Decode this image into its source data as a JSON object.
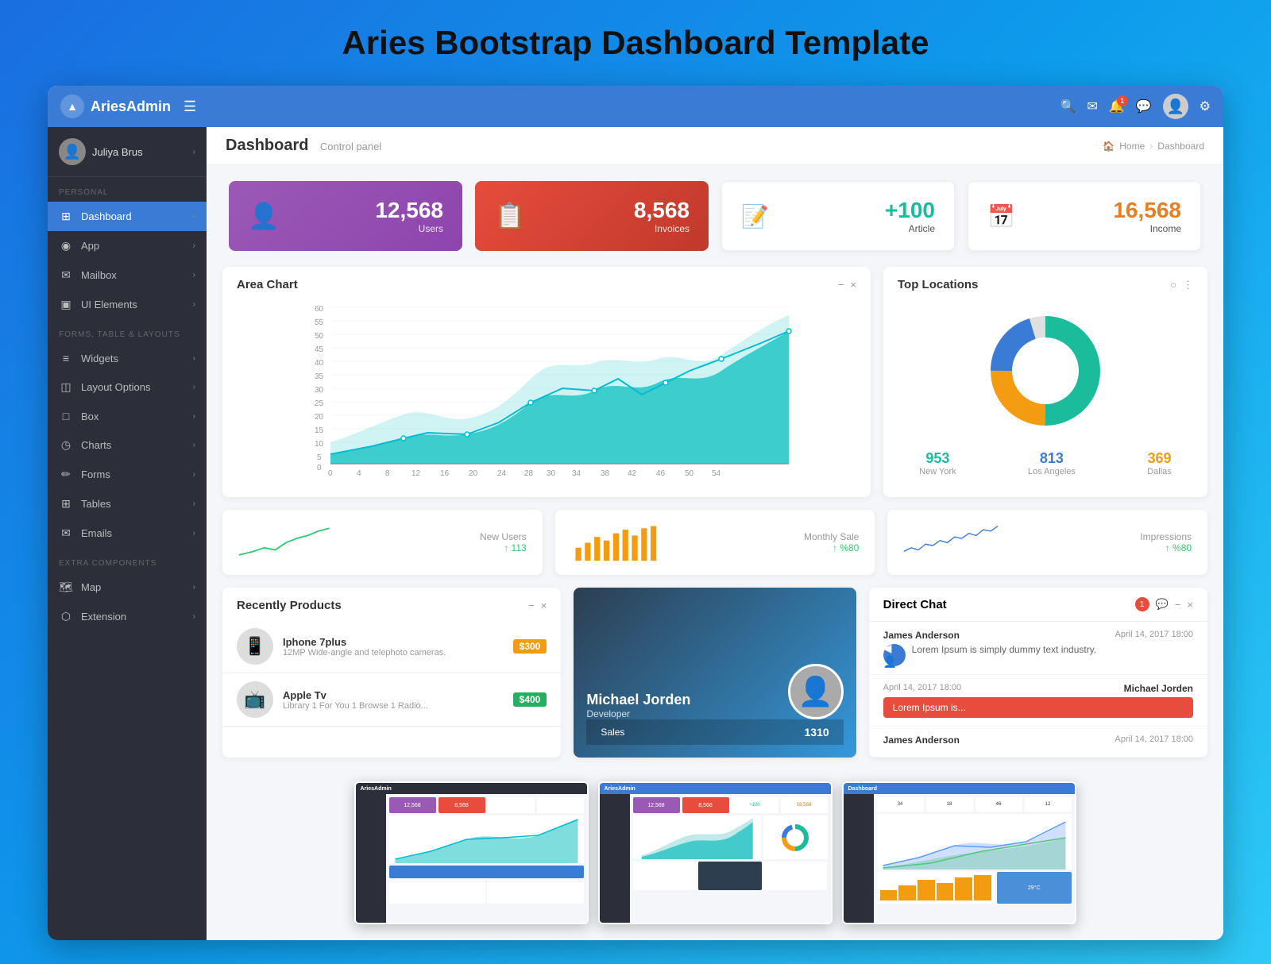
{
  "page": {
    "title": "Aries Bootstrap Dashboard Template"
  },
  "topnav": {
    "logo_text_aries": "Aries",
    "logo_text_admin": "Admin",
    "hamburger_icon": "☰",
    "search_icon": "🔍",
    "mail_icon": "✉",
    "bell_icon": "🔔",
    "chat_icon": "💬",
    "avatar_icon": "👤",
    "gear_icon": "⚙",
    "notification_count": "1"
  },
  "sidebar": {
    "user_name": "Juliya Brus",
    "sections": [
      {
        "label": "PERSONAL",
        "items": [
          {
            "icon": "⊞",
            "label": "Dashboard",
            "active": true
          },
          {
            "icon": "◉",
            "label": "App"
          },
          {
            "icon": "✉",
            "label": "Mailbox"
          },
          {
            "icon": "▣",
            "label": "UI Elements"
          }
        ]
      },
      {
        "label": "FORMS, TABLE & LAYOUTS",
        "items": [
          {
            "icon": "≡",
            "label": "Widgets"
          },
          {
            "icon": "◫",
            "label": "Layout Options"
          },
          {
            "icon": "□",
            "label": "Box"
          },
          {
            "icon": "◷",
            "label": "Charts"
          },
          {
            "icon": "✏",
            "label": "Forms"
          },
          {
            "icon": "⊞",
            "label": "Tables"
          },
          {
            "icon": "✉",
            "label": "Emails"
          }
        ]
      },
      {
        "label": "EXTRA COMPONENTS",
        "items": [
          {
            "icon": "🗺",
            "label": "Map"
          },
          {
            "icon": "⬡",
            "label": "Extension"
          }
        ]
      }
    ]
  },
  "content_header": {
    "title": "Dashboard",
    "subtitle": "Control panel",
    "breadcrumb": [
      "Home",
      "Dashboard"
    ]
  },
  "stat_cards": [
    {
      "icon": "👤",
      "value": "12,568",
      "label": "Users",
      "variant": "purple"
    },
    {
      "icon": "📋",
      "value": "8,568",
      "label": "Invoices",
      "variant": "red"
    },
    {
      "icon": "📝",
      "value": "+100",
      "label": "Article",
      "variant": "white"
    },
    {
      "icon": "📅",
      "value": "16,568",
      "label": "Income",
      "variant": "white2"
    }
  ],
  "area_chart": {
    "title": "Area Chart",
    "y_labels": [
      "60",
      "55",
      "50",
      "45",
      "40",
      "35",
      "30",
      "25",
      "20",
      "15",
      "10",
      "5",
      "0"
    ],
    "x_labels": [
      "0",
      "4",
      "8",
      "12",
      "16",
      "20",
      "24",
      "28",
      "30",
      "34",
      "38",
      "42",
      "46",
      "50",
      "54"
    ]
  },
  "top_locations": {
    "title": "Top Locations",
    "stats": [
      {
        "value": "953",
        "label": "New York",
        "color": "teal"
      },
      {
        "value": "813",
        "label": "Los Angeles",
        "color": "blue"
      },
      {
        "value": "369",
        "label": "Dallas",
        "color": "yellow"
      }
    ]
  },
  "mini_stats": [
    {
      "label": "New Users",
      "value": "113",
      "change": "↑",
      "chart_type": "line_green"
    },
    {
      "label": "Monthly Sale",
      "value": "%80",
      "change": "↑",
      "chart_type": "bar_yellow"
    },
    {
      "label": "Impressions",
      "value": "%80",
      "change": "↑",
      "chart_type": "line_blue"
    }
  ],
  "recently_products": {
    "title": "Recently Products",
    "items": [
      {
        "name": "Iphone 7plus",
        "desc": "12MP Wide-angle and telephoto cameras.",
        "price": "$300",
        "price_color": "orange"
      },
      {
        "name": "Apple Tv",
        "desc": "Library 1 For You 1 Browse 1 Radio...",
        "price": "$400",
        "price_color": "green"
      }
    ]
  },
  "profile_card": {
    "name": "Michael Jorden",
    "role": "Developer",
    "footer_label": "Sales",
    "footer_value": "1310"
  },
  "direct_chat": {
    "title": "Direct Chat",
    "badge": "1",
    "messages": [
      {
        "sender": "James Anderson",
        "time": "April 14, 2017 18:00",
        "text": "Lorem Ipsum is simply dummy text industry.",
        "direction": "left"
      },
      {
        "sender": "Michael Jorden",
        "time": "April 14, 2017 18:00",
        "text": "Lorem Ipsum is...",
        "direction": "right",
        "highlight": true
      },
      {
        "sender": "James Anderson",
        "time": "April 14, 2017 18:00",
        "text": "",
        "direction": "left"
      }
    ]
  }
}
